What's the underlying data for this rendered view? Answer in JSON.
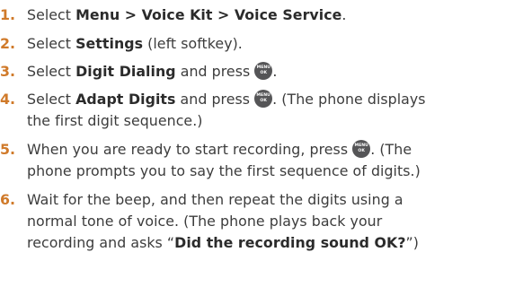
{
  "menu_button_icon": {
    "top_text": "MENU",
    "bottom_text": "OK",
    "color": "#555557"
  },
  "number_color": "#d07a2a",
  "steps": [
    {
      "num": "1.",
      "l1a": "Select ",
      "l1b": "Menu > Voice Kit > Voice Service",
      "l1c": "."
    },
    {
      "num": "2.",
      "l1a": "Select ",
      "l1b": "Settings",
      "l1c": " (left softkey)."
    },
    {
      "num": "3.",
      "l1a": "Select ",
      "l1b": "Digit Dialing",
      "l1c": " and press ",
      "l1d": "."
    },
    {
      "num": "4.",
      "l1a": "Select ",
      "l1b": "Adapt Digits",
      "l1c": " and press ",
      "l1d": ". (The phone displays",
      "l2": "the first digit sequence.)"
    },
    {
      "num": "5.",
      "l1a": "When you are ready to start recording, press ",
      "l1b": ". (The",
      "l2": "phone prompts you to say the first sequence of digits.)"
    },
    {
      "num": "6.",
      "l1": "Wait for the beep, and then repeat the digits using a",
      "l2": "normal tone of voice. (The phone plays back your",
      "l3a": "recording and asks “",
      "l3b": "Did the recording sound OK?",
      "l3c": "”)"
    }
  ]
}
